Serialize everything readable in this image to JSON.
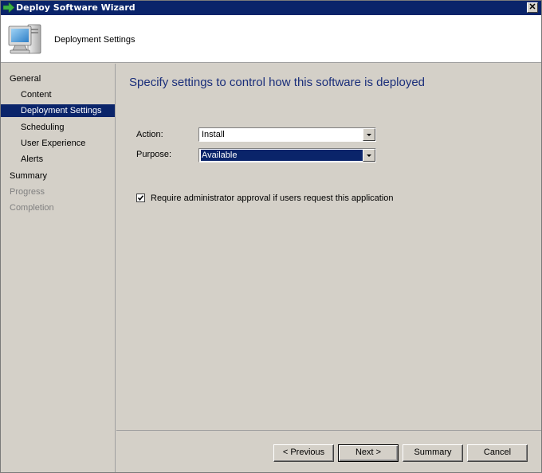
{
  "window": {
    "title": "Deploy Software Wizard",
    "close_glyph": "✕"
  },
  "header": {
    "title": "Deployment Settings",
    "icon": "computer-icon"
  },
  "sidebar": {
    "items": [
      {
        "label": "General",
        "state": "normal"
      },
      {
        "label": "Content",
        "state": "normal"
      },
      {
        "label": "Deployment Settings",
        "state": "selected"
      },
      {
        "label": "Scheduling",
        "state": "normal"
      },
      {
        "label": "User Experience",
        "state": "normal"
      },
      {
        "label": "Alerts",
        "state": "normal"
      },
      {
        "label": "Summary",
        "state": "normal"
      },
      {
        "label": "Progress",
        "state": "disabled"
      },
      {
        "label": "Completion",
        "state": "disabled"
      }
    ]
  },
  "main": {
    "heading": "Specify settings to control how this software is deployed",
    "action_label": "Action:",
    "action_value": "Install",
    "purpose_label": "Purpose:",
    "purpose_value": "Available",
    "approval_label": "Require administrator approval if users request this application",
    "approval_checked": true
  },
  "footer": {
    "previous": "< Previous",
    "next": "Next >",
    "summary": "Summary",
    "cancel": "Cancel"
  },
  "colors": {
    "titlebar": "#0a246a",
    "selection": "#0a246a",
    "heading": "#1a2e7a",
    "face": "#d4d0c8"
  }
}
